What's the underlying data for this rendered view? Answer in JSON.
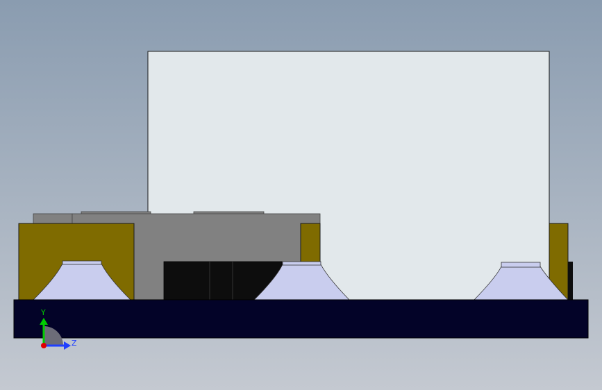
{
  "viewport": {
    "background_top": "#8a9cb0",
    "background_bottom": "#c4c9d1"
  },
  "model": {
    "colors": {
      "panel": "#e2e8eb",
      "base_plate": "#030328",
      "olive_block": "#7f6b00",
      "gray_housing": "#818181",
      "dark_cavity": "#0d0d0d",
      "suction_cup": "#c9cdee",
      "edge": "#1a1a1a"
    }
  },
  "triad": {
    "y_label": "Y",
    "z_label": "Z",
    "y_color": "#00cc00",
    "z_color": "#1f3fff",
    "x_color": "#e00000"
  }
}
